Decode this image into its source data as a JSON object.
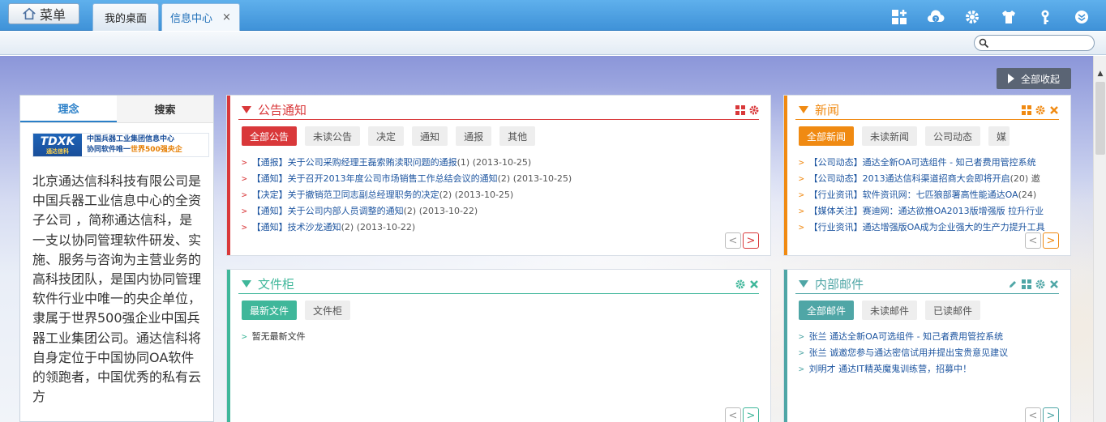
{
  "header": {
    "menu_label": "菜单",
    "tabs": [
      {
        "label": "我的桌面",
        "active": false
      },
      {
        "label": "信息中心",
        "active": true,
        "close": "×"
      }
    ],
    "icons": [
      "add-widget-icon",
      "cloud-help-icon",
      "gear-icon",
      "shirt-icon",
      "key-icon",
      "expand-down-icon"
    ]
  },
  "toolbar": {
    "collapse_all_label": "全部收起"
  },
  "left_panel": {
    "tabs": [
      "理念",
      "搜索"
    ],
    "logo": {
      "mark": "TDXK",
      "mark_sub": "通达信科",
      "line1": "中国兵器工业集团信息中心",
      "line2_a": "协同软件唯一",
      "line2_b": "世界500强央企"
    },
    "text": "北京通达信科科技有限公司是中国兵器工业信息中心的全资子公司 ，简称通达信科，是一支以协同管理软件研发、实施、服务与咨询为主营业务的高科技团队，是国内协同管理软件行业中唯一的央企单位，隶属于世界500强企业中国兵器工业集团公司。通达信科将自身定位于中国协同OA软件的领跑者，中国优秀的私有云方"
  },
  "notice": {
    "title": "公告通知",
    "color": "#d9383a",
    "buttons": [
      "全部公告",
      "未读公告",
      "决定",
      "通知",
      "通报",
      "其他"
    ],
    "items": [
      {
        "text": "【通报】关于公司采购经理王磊索贿渎职问题的通报",
        "meta": "(1)  (2013-10-25)"
      },
      {
        "text": "【通知】关于召开2013年度公司市场销售工作总结会议的通知",
        "meta": "(2)  (2013-10-25)"
      },
      {
        "text": "【决定】关于撤销范卫同志副总经理职务的决定",
        "meta": "(2)  (2013-10-25)"
      },
      {
        "text": "【通知】关于公司内部人员调整的通知",
        "meta": "(2)  (2013-10-22)"
      },
      {
        "text": "【通知】技术沙龙通知",
        "meta": "(2)  (2013-10-22)"
      }
    ]
  },
  "news": {
    "title": "新闻",
    "color": "#f08a12",
    "buttons": [
      "全部新闻",
      "未读新闻",
      "公司动态",
      "媒"
    ],
    "items": [
      {
        "text": "【公司动态】通达全新OA可选组件 - 知己者费用管控系统",
        "meta": ""
      },
      {
        "text": "【公司动态】2013通达信科渠道招商大会即将开启",
        "meta": "(20)  邀"
      },
      {
        "text": "【行业资讯】软件资讯网：七匹狼部署高性能通达OA",
        "meta": "(24)"
      },
      {
        "text": "【媒体关注】赛迪网：通达欲推OA2013版增强版 拉升行业",
        "meta": ""
      },
      {
        "text": "【行业资讯】通达增强版OA成为企业强大的生产力提升工具",
        "meta": ""
      }
    ]
  },
  "files": {
    "title": "文件柜",
    "color": "#3fb79a",
    "buttons": [
      "最新文件",
      "文件柜"
    ],
    "items": [
      {
        "text": "暂无最新文件",
        "meta": ""
      }
    ]
  },
  "mail": {
    "title": "内部邮件",
    "color": "#4fa6a6",
    "buttons": [
      "全部邮件",
      "未读邮件",
      "已读邮件"
    ],
    "items": [
      {
        "text": "张兰 通达全新OA可选组件 - 知己者费用管控系统",
        "meta": ""
      },
      {
        "text": "张兰 诚邀您参与通达密信试用并提出宝贵意见建议",
        "meta": ""
      },
      {
        "text": "刘明才 通达IT精英魔鬼训练营，招募中！",
        "meta": ""
      }
    ]
  },
  "pager": {
    "prev": "<",
    "next": ">"
  }
}
